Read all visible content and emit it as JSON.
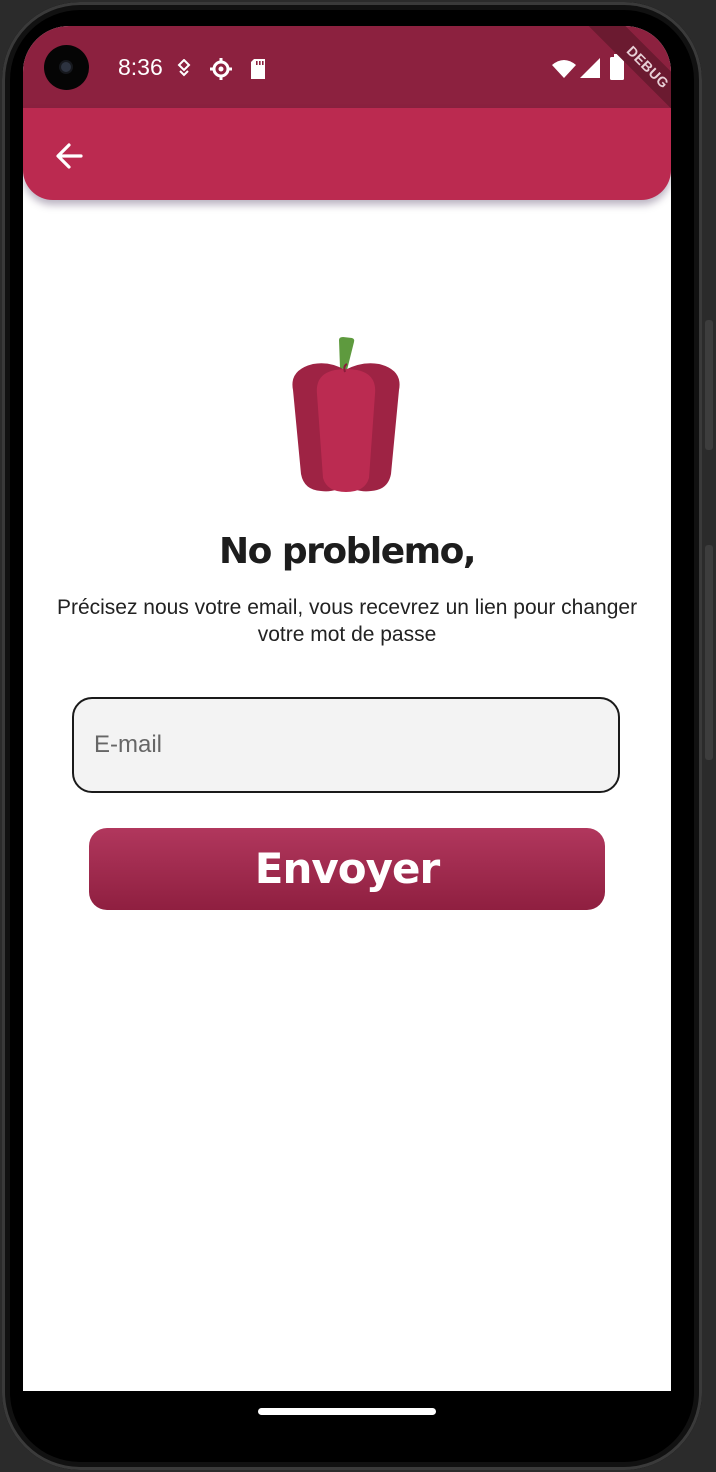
{
  "status_bar": {
    "time": "8:36",
    "left_icons": [
      "location-pin-icon",
      "settings-gear-icon",
      "sd-card-icon"
    ],
    "right_icons": [
      "wifi-icon",
      "cell-signal-icon",
      "battery-icon"
    ],
    "debug_label": "DEBUG"
  },
  "app_bar": {
    "back_icon": "arrow-left-icon"
  },
  "content": {
    "logo_icon": "bell-pepper-icon",
    "title": "No problemo,",
    "subtitle": "Précisez nous votre email, vous recevrez un lien pour changer votre mot de passe",
    "email_placeholder": "E-mail",
    "email_value": "",
    "submit_label": "Envoyer"
  },
  "colors": {
    "status_bar": "#8c213f",
    "app_bar": "#bb2a50",
    "button_top": "#b1375d",
    "button_bottom": "#8f1f40",
    "pepper": "#b82a4f",
    "stem": "#5e9a3e"
  }
}
